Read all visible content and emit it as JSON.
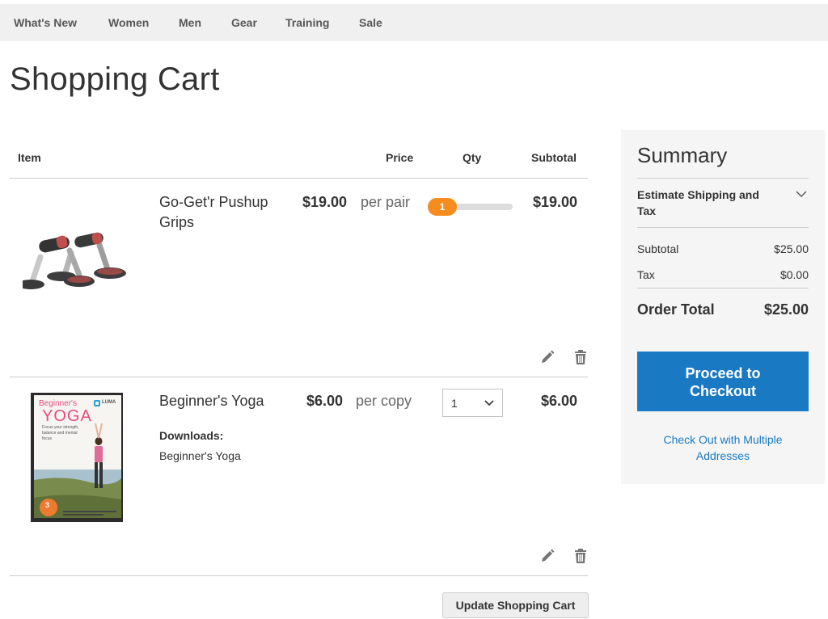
{
  "nav": {
    "items": [
      "What's New",
      "Women",
      "Men",
      "Gear",
      "Training",
      "Sale"
    ]
  },
  "page": {
    "title": "Shopping Cart"
  },
  "cart": {
    "headers": {
      "item": "Item",
      "price": "Price",
      "qty": "Qty",
      "subtotal": "Subtotal"
    },
    "items": [
      {
        "name": "Go-Get'r Pushup Grips",
        "price": "$19.00",
        "unit": "per pair",
        "qty": "1",
        "qty_control": "slider",
        "subtotal": "$19.00"
      },
      {
        "name": "Beginner's Yoga",
        "price": "$6.00",
        "unit": "per copy",
        "qty": "1",
        "qty_control": "select",
        "subtotal": "$6.00",
        "downloads_label": "Downloads:",
        "downloads": "Beginner's Yoga",
        "cover": {
          "title_small": "Beginner's",
          "title_big": "YOGA",
          "brand": "LUMA",
          "tagline": "Focus your strength, balance and mental focus",
          "badge": "3"
        }
      }
    ],
    "update_label": "Update Shopping Cart"
  },
  "summary": {
    "title": "Summary",
    "estimate_label": "Estimate Shipping and Tax",
    "subtotal_label": "Subtotal",
    "subtotal_value": "$25.00",
    "tax_label": "Tax",
    "tax_value": "$0.00",
    "total_label": "Order Total",
    "total_value": "$25.00",
    "checkout_label": "Proceed to Checkout",
    "multi_label": "Check Out with Multiple Addresses"
  },
  "colors": {
    "accent": "#1979c3",
    "slider_handle": "#f68c1f",
    "nav_bg": "#f0f0f0",
    "summary_bg": "#f5f5f5"
  },
  "icons": [
    "pencil-icon",
    "trash-icon",
    "chevron-down-icon"
  ]
}
